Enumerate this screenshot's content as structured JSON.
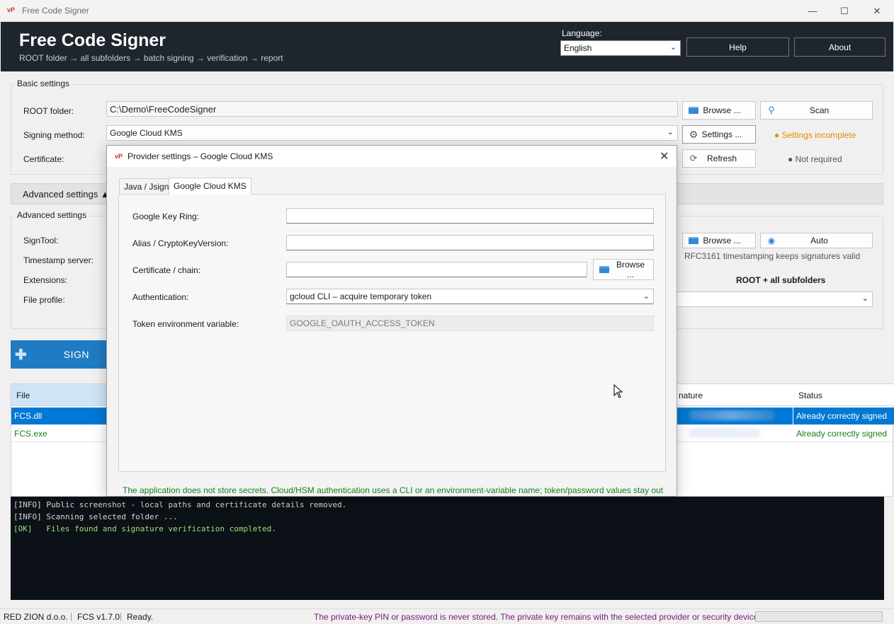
{
  "window": {
    "title": "Free Code Signer",
    "icon_text": "vP",
    "min_glyph": "—",
    "max_glyph": "☐",
    "close_glyph": "✕"
  },
  "header": {
    "title": "Free Code Signer",
    "subtitle": "ROOT folder → all subfolders → batch signing → verification → report",
    "language_label": "Language:",
    "language_value": "English",
    "help_label": "Help",
    "about_label": "About"
  },
  "basic": {
    "title": "Basic settings",
    "root_label": "ROOT folder:",
    "root_value": "C:\\Demo\\FreeCodeSigner",
    "browse_label": "Browse ...",
    "scan_label": "Scan",
    "method_label": "Signing method:",
    "method_value": "Google Cloud KMS",
    "settings_label": "Settings ...",
    "settings_status": "● Settings incomplete",
    "certificate_label": "Certificate:",
    "refresh_label": "Refresh",
    "not_required": "● Not required"
  },
  "advanced": {
    "bar_label": "Advanced settings ▲",
    "title": "Advanced settings",
    "signtool_label": "SignTool:",
    "timestamp_label": "Timestamp server:",
    "extensions_label": "Extensions:",
    "profile_label": "File profile:",
    "browse_label": "Browse ...",
    "auto_label": "Auto",
    "timestamp_note": "RFC3161 timestamping keeps signatures valid",
    "scope_label": "ROOT + all subfolders"
  },
  "sign_button": {
    "label": "SIGN"
  },
  "table": {
    "columns": [
      "File",
      "nature",
      "Status"
    ],
    "rows": [
      {
        "file": "FCS.dll",
        "status": "Already correctly signed",
        "selected": true
      },
      {
        "file": "FCS.exe",
        "status": "Already correctly signed",
        "selected": false
      }
    ]
  },
  "log": {
    "lines": [
      {
        "text": "[INFO] Public screenshot - local paths and certificate details removed.",
        "kind": "info"
      },
      {
        "text": "[INFO] Scanning selected folder ...",
        "kind": "info"
      },
      {
        "text": "[OK]   Files found and signature verification completed.",
        "kind": "ok"
      }
    ]
  },
  "statusbar": {
    "company": "RED ZION d.o.o.",
    "version": "FCS v1.7.0",
    "state": "Ready.",
    "notice": "The private-key PIN or password is never stored. The private key remains with the selected provider or security device."
  },
  "dialog": {
    "icon_text": "vP",
    "title": "Provider settings – Google Cloud KMS",
    "close_glyph": "✕",
    "tabs": [
      "Java / Jsign",
      "Google Cloud KMS"
    ],
    "key_ring_label": "Google Key Ring:",
    "key_ring_value": "",
    "alias_label": "Alias / CryptoKeyVersion:",
    "alias_value": "",
    "cert_label": "Certificate / chain:",
    "cert_value": "",
    "browse_label": "Browse ...",
    "auth_label": "Authentication:",
    "auth_value": "gcloud CLI – acquire temporary token",
    "token_label": "Token environment variable:",
    "token_value": "GOOGLE_OAUTH_ACCESS_TOKEN",
    "note": "The application does not store secrets. Cloud/HSM authentication uses a CLI or an environment-variable name; token/password values stay out"
  },
  "colors": {
    "header_bg": "#1e252d",
    "accent": "#1f7cc4",
    "selection": "#0078d4",
    "warning": "#e68a00",
    "ok_text": "#1a7d1a",
    "notice": "#7a1a7a"
  }
}
